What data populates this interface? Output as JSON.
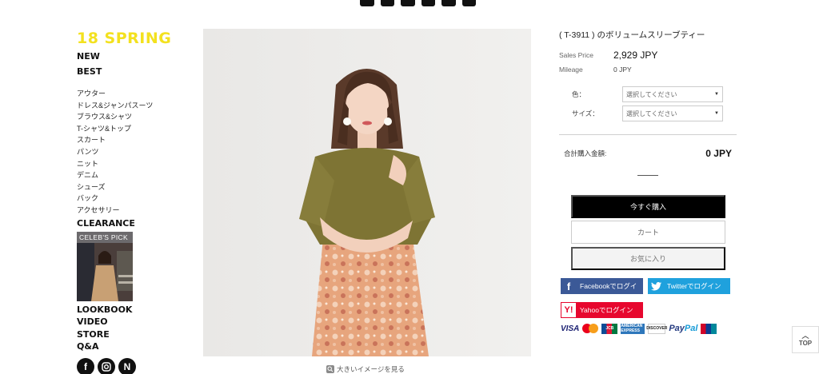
{
  "sidebar": {
    "season": "18 SPRING",
    "new": "NEW",
    "best": "BEST",
    "categories": [
      "アウター",
      "ドレス&ジャンパスーツ",
      "ブラウス&シャツ",
      "T-シャツ&トップ",
      "スカート",
      "パンツ",
      "ニット",
      "デニム",
      "シューズ",
      "バック",
      "アクセサリー"
    ],
    "clearance": "CLEARANCE",
    "celeb_label": "CELEB'S PICK",
    "lookbook": "LOOKBOOK",
    "video": "VIDEO",
    "store": "STORE",
    "qa": "Q&A",
    "social_icons": [
      "facebook-icon",
      "instagram-icon",
      "naver-icon"
    ]
  },
  "product": {
    "name": "( T-3911 ) のボリュームスリーブティー",
    "sales_price_label": "Sales Price",
    "sales_price": "2,929 JPY",
    "mileage_label": "Mileage",
    "mileage": "0 JPY",
    "color_label": "色：",
    "size_label": "サイズ：",
    "select_placeholder": "選択してください",
    "total_label": "合計購入金額:",
    "total_value": "0 JPY",
    "zoom_text": "大きいイメージを見る"
  },
  "buttons": {
    "buy": "今すぐ購入",
    "cart": "カート",
    "favorite": "お気に入り",
    "facebook": "Facebookでログイ",
    "twitter": "Twitterでログイン",
    "yahoo": "Yahooでログイン"
  },
  "payment_methods": [
    "VISA",
    "MasterCard",
    "JCB",
    "AMERICAN EXPRESS",
    "DISCOVER",
    "PayPal",
    "UnionPay"
  ],
  "top_button": "TOP",
  "colors": {
    "season_yellow": "#f3e11f",
    "buy_black": "#000000",
    "facebook_blue": "#3b5997",
    "twitter_blue": "#1fa1dd",
    "yahoo_red": "#e7072e"
  }
}
